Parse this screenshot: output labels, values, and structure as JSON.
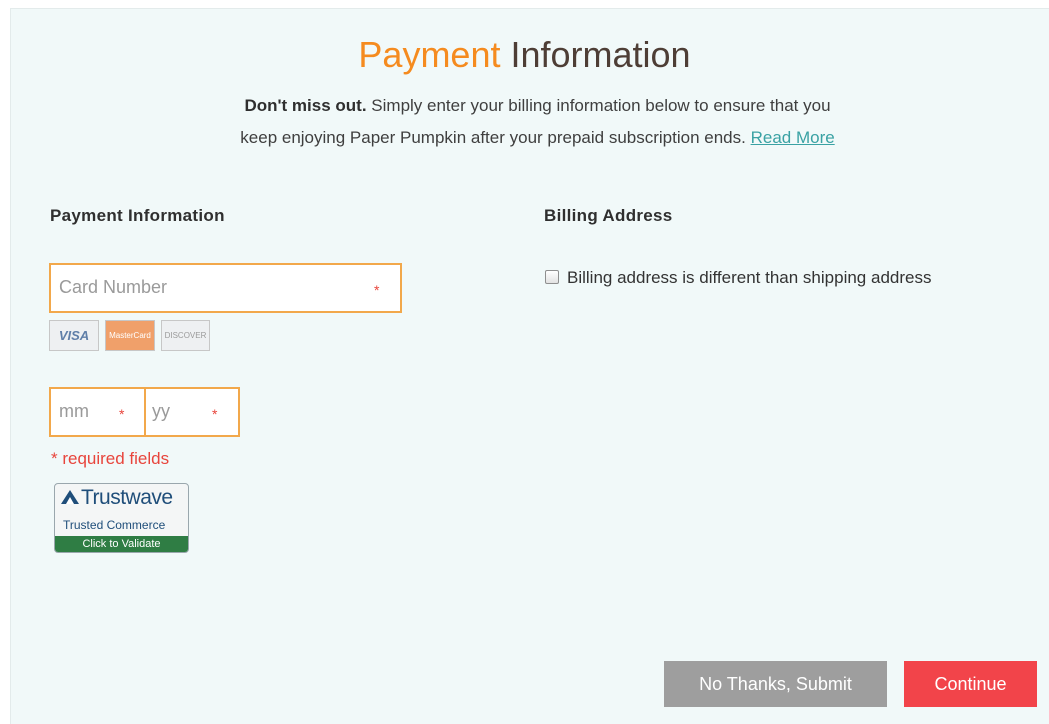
{
  "header": {
    "title_accent": "Payment",
    "title_rest": " Information",
    "intro_bold": "Don't miss out.",
    "intro_line1": " Simply enter your billing information below to ensure that you",
    "intro_line2": "keep enjoying Paper Pumpkin after your prepaid subscription ends. ",
    "read_more": "Read More"
  },
  "payment": {
    "heading": "Payment Information",
    "card_number_placeholder": "Card Number",
    "month_placeholder": "mm",
    "year_placeholder": "yy",
    "required_star": "*",
    "required_note": "* required fields",
    "card_logos": [
      "VISA",
      "MasterCard",
      "DISCOVER"
    ]
  },
  "trustwave": {
    "brand": "Trustwave",
    "tagline": "Trusted Commerce",
    "action": "Click to Validate"
  },
  "billing": {
    "heading": "Billing Address",
    "checkbox_label": "Billing address is different than shipping address",
    "checkbox_checked": false
  },
  "buttons": {
    "no_thanks": "No Thanks, Submit",
    "continue": "Continue"
  },
  "colors": {
    "accent_orange": "#f58b1f",
    "link_teal": "#3aa2a4",
    "required_red": "#e8453c",
    "continue_red": "#f2444a",
    "submit_gray": "#9e9e9e",
    "panel_bg": "#f1f9f9"
  }
}
